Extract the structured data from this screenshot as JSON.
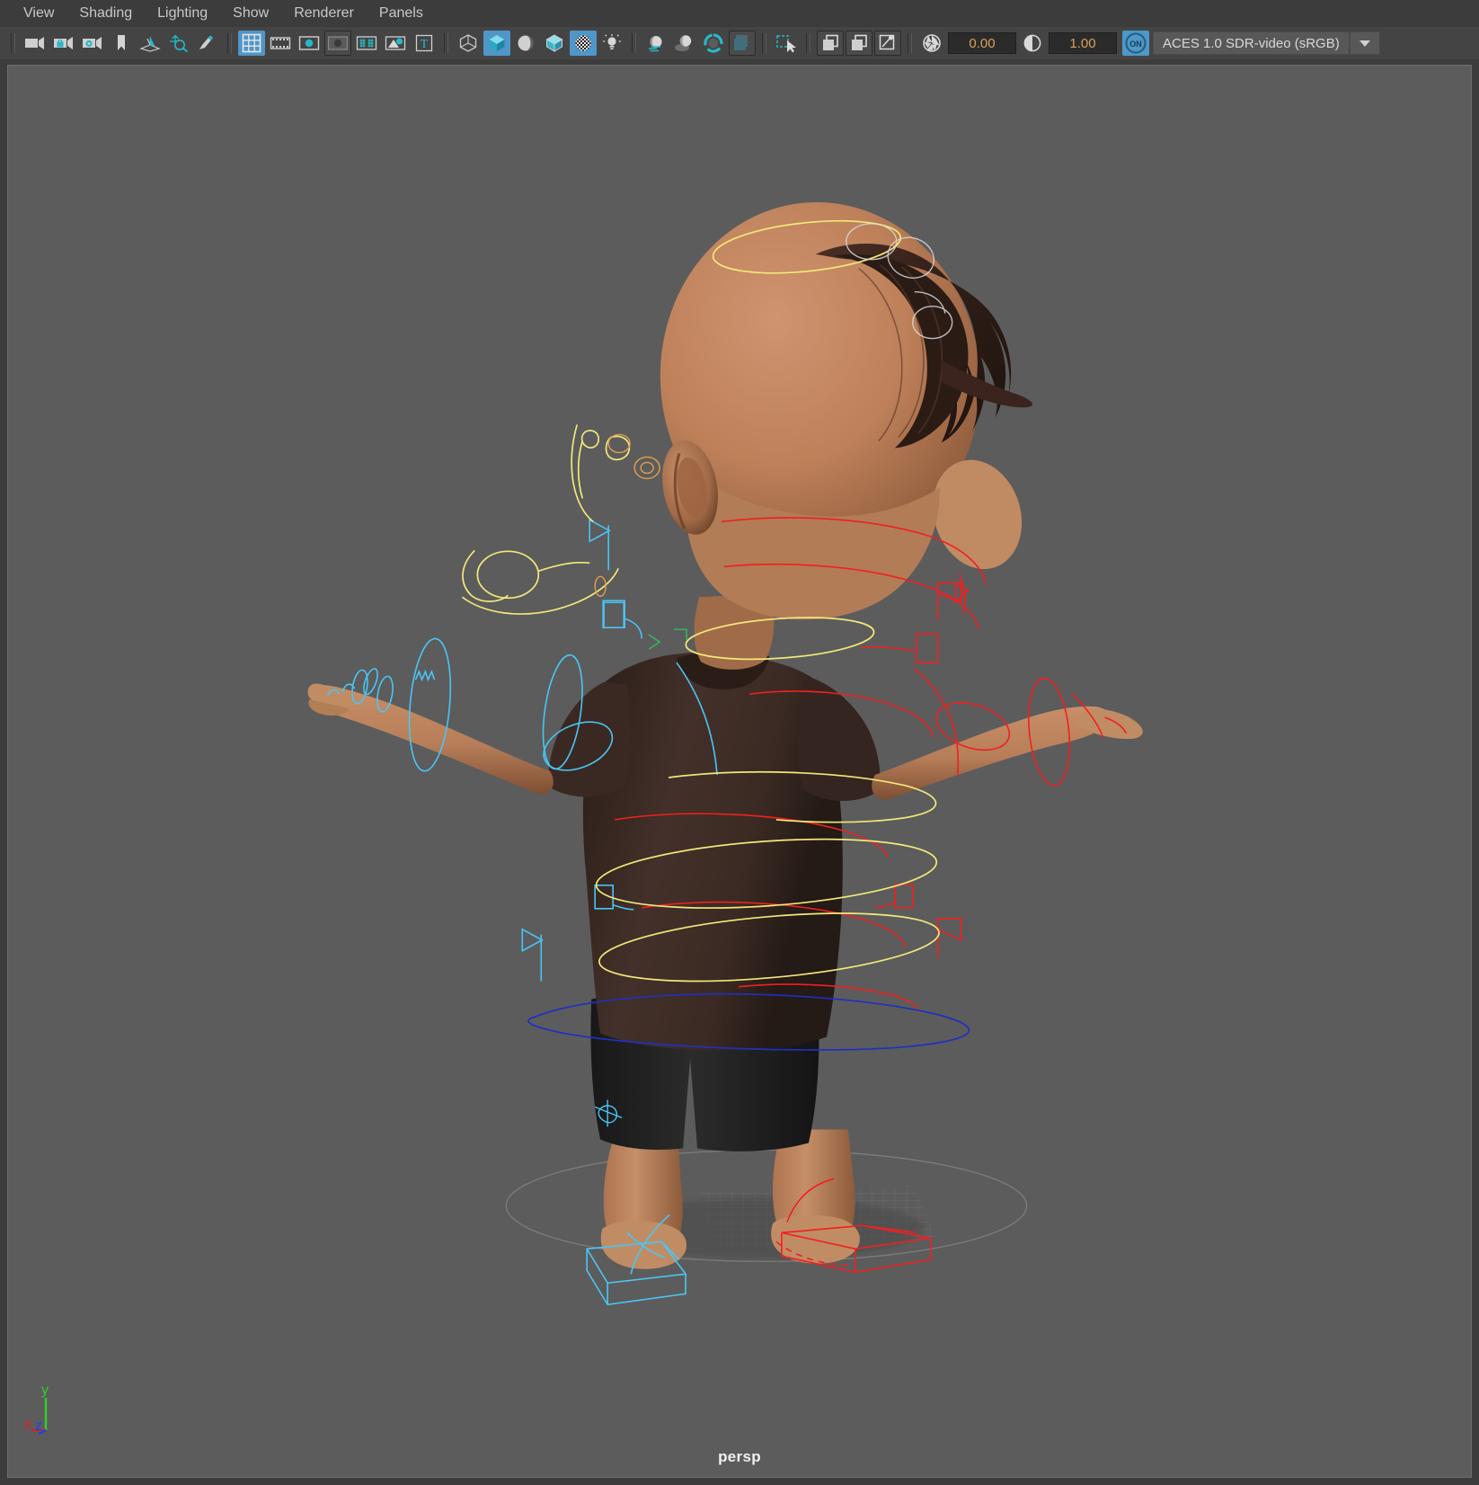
{
  "app": {
    "viewport_camera": "persp",
    "background_color": "#5c5c5c",
    "accent_color": "#5096c8"
  },
  "menubar": {
    "items": [
      {
        "label": "View",
        "name": "menu-view"
      },
      {
        "label": "Shading",
        "name": "menu-shading"
      },
      {
        "label": "Lighting",
        "name": "menu-lighting"
      },
      {
        "label": "Show",
        "name": "menu-show"
      },
      {
        "label": "Renderer",
        "name": "menu-renderer"
      },
      {
        "label": "Panels",
        "name": "menu-panels"
      }
    ]
  },
  "toolbar": {
    "icons": [
      {
        "name": "select-camera-icon",
        "glyph": "camera",
        "active": false
      },
      {
        "name": "lock-camera-icon",
        "glyph": "camera-lock",
        "active": false
      },
      {
        "name": "camera-attributes-icon",
        "glyph": "camera-gear",
        "active": false
      },
      {
        "name": "bookmark-icon",
        "glyph": "bookmark",
        "active": false
      },
      {
        "name": "image-plane-icon",
        "glyph": "image-plane",
        "active": false
      },
      {
        "name": "two-d-pan-zoom-icon",
        "glyph": "pan-zoom",
        "active": false
      },
      {
        "name": "grease-pencil-icon",
        "glyph": "pencil",
        "active": false
      },
      {
        "name": "grid-toggle-icon",
        "glyph": "grid",
        "active": true
      },
      {
        "name": "film-gate-icon",
        "glyph": "film-gate",
        "active": false
      },
      {
        "name": "resolution-gate-icon",
        "glyph": "resolution-gate",
        "active": false
      },
      {
        "name": "gate-mask-icon",
        "glyph": "gate-mask",
        "active": false
      },
      {
        "name": "field-chart-icon",
        "glyph": "field-chart",
        "active": false
      },
      {
        "name": "safe-action-icon",
        "glyph": "safe-action",
        "active": false
      },
      {
        "name": "text-overlay-icon",
        "glyph": "text",
        "active": false
      },
      {
        "name": "wireframe-shading-icon",
        "glyph": "cube-wire",
        "active": false
      },
      {
        "name": "smooth-shade-all-icon",
        "glyph": "cube-solid",
        "active": true
      },
      {
        "name": "flat-shade-icon",
        "glyph": "sphere-half",
        "active": false
      },
      {
        "name": "shaded-wireframe-icon",
        "glyph": "cube-hybrid",
        "active": false
      },
      {
        "name": "textured-shading-icon",
        "glyph": "checker-sphere",
        "active": true
      },
      {
        "name": "use-all-lights-icon",
        "glyph": "bulb",
        "active": false
      },
      {
        "name": "two-sided-lighting-icon",
        "glyph": "sphere-shade",
        "active": false
      },
      {
        "name": "shadows-icon",
        "glyph": "sphere-shadow",
        "active": false
      },
      {
        "name": "screen-space-ao-icon",
        "glyph": "sphere-cast",
        "active": false
      },
      {
        "name": "motion-blur-icon",
        "glyph": "pac-ring",
        "active": false
      },
      {
        "name": "multisample-aa-icon",
        "glyph": "aa-square",
        "active": false
      },
      {
        "name": "isolate-select-icon",
        "glyph": "marquee-arrow",
        "active": false
      },
      {
        "name": "xray-toggle-icon",
        "glyph": "xray",
        "active": false
      },
      {
        "name": "xray-joints-icon",
        "glyph": "xray-joint",
        "active": false
      },
      {
        "name": "xray-active-components-icon",
        "glyph": "xray-comp",
        "active": false
      }
    ],
    "exposure": {
      "label": "exposure",
      "value": "0.00",
      "icon": "aperture-icon"
    },
    "gamma": {
      "label": "gamma",
      "value": "1.00",
      "icon": "contrast-icon"
    },
    "color_management": {
      "toggle_label": "ON",
      "toggle_name": "color-management-toggle",
      "view_transform": "ACES 1.0 SDR-video (sRGB)",
      "dropdown_name": "view-transform-dropdown"
    }
  },
  "viewport": {
    "camera_label": "persp",
    "axis_gizmo": {
      "x_label": "x",
      "x_color": "#e02020",
      "y_label": "y",
      "y_color": "#2ed02e",
      "z_label": "z",
      "z_color": "#2040e8"
    },
    "scene": {
      "description": "rigged cartoon child character, back view, T-pose",
      "skin_color": "#c08662",
      "skin_shadow": "#8c5a3c",
      "hair_color": "#3a241d",
      "shirt_color": "#3d2b25",
      "shorts_color": "#232323",
      "control_colors": {
        "left_side": "#49c6f5",
        "right_side": "#f02020",
        "center_spine": "#f2e87a",
        "hips": "#2030c0",
        "head_extra": "#d8d8d8",
        "ground_grid": "#7a7a7a"
      }
    }
  }
}
